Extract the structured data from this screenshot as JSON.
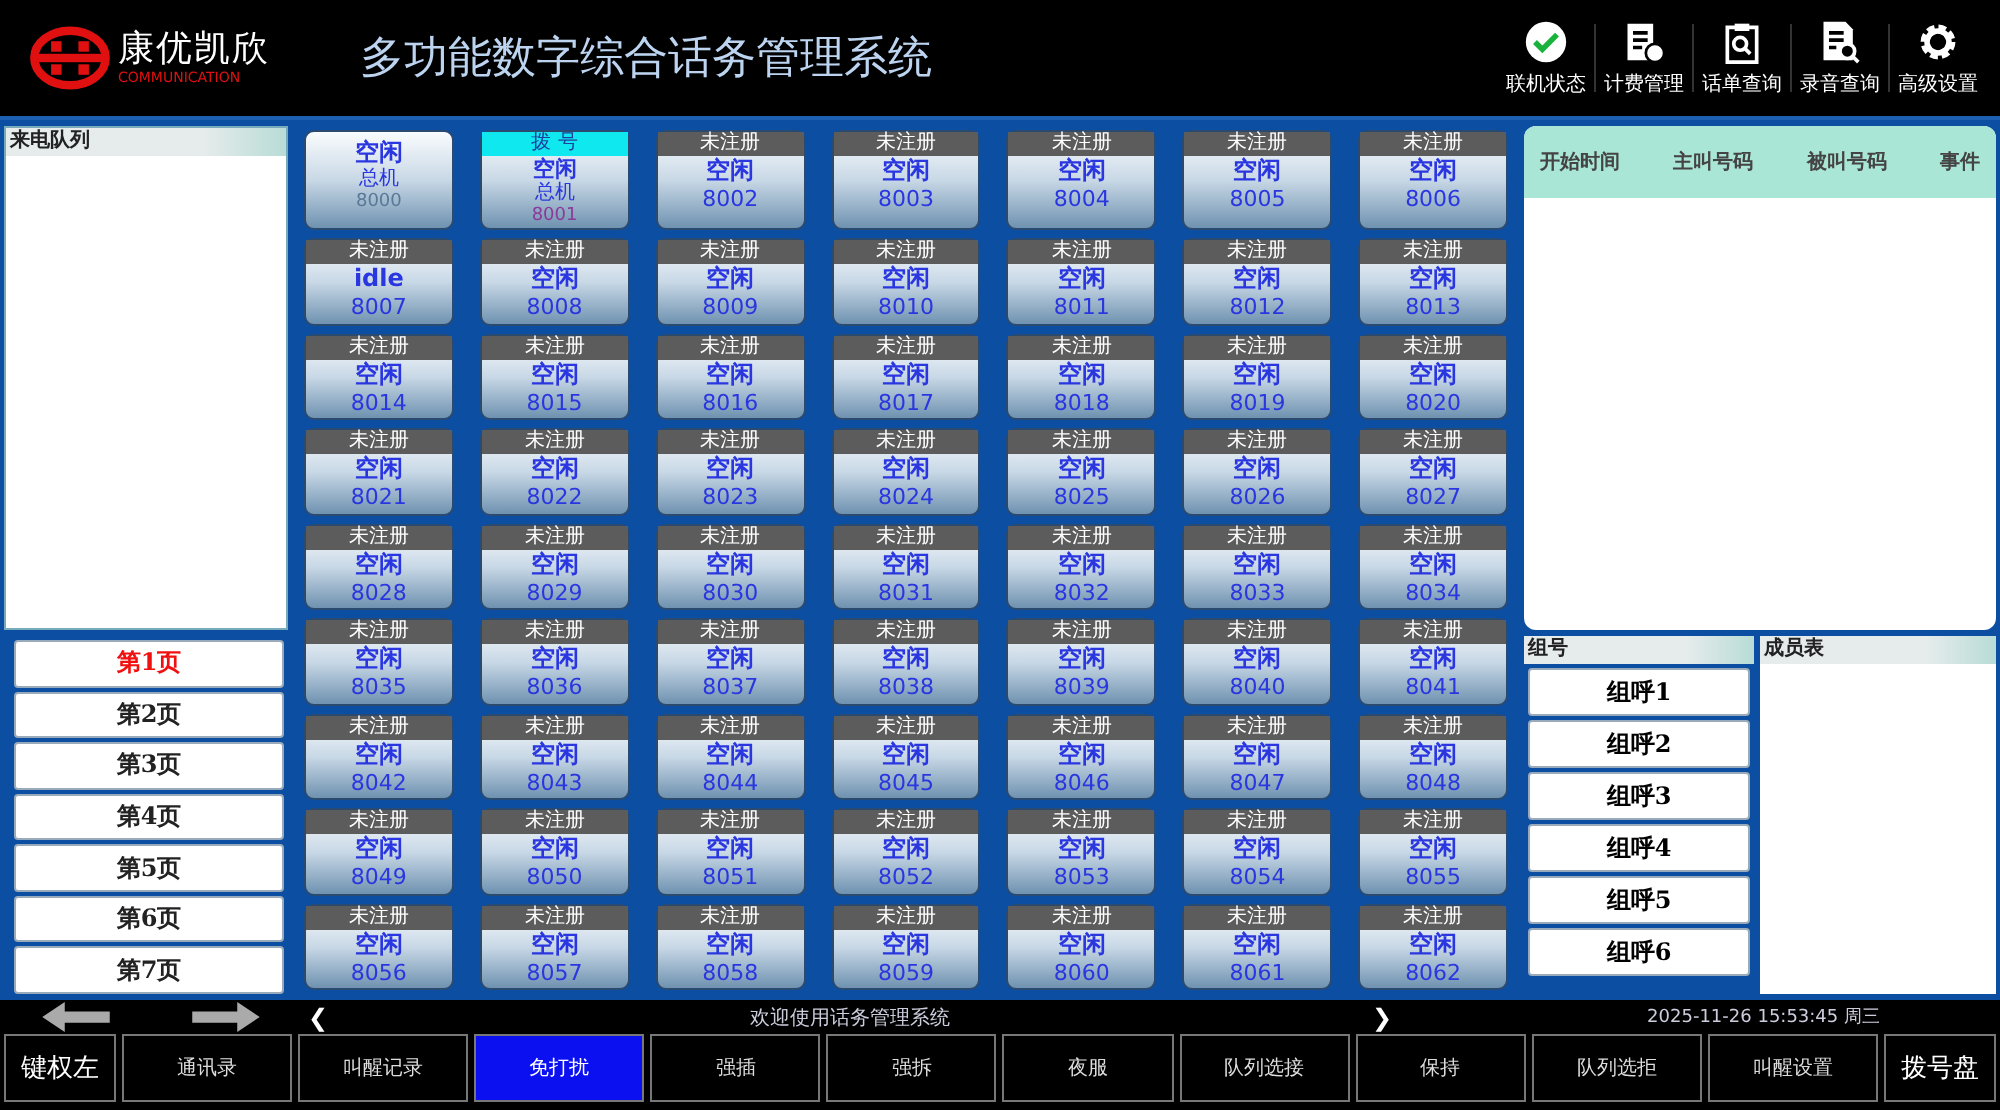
{
  "header": {
    "logo_text": "康优凯欣",
    "logo_sub": "COMMUNICATION",
    "title": "多功能数字综合话务管理系统",
    "tools": [
      {
        "kind": "check",
        "label": "联机状态"
      },
      {
        "kind": "billing",
        "label": "计费管理"
      },
      {
        "kind": "clipboard",
        "label": "话单查询"
      },
      {
        "kind": "document",
        "label": "录音查询"
      },
      {
        "kind": "gear",
        "label": "高级设置"
      }
    ]
  },
  "queue": {
    "title": "来电队列"
  },
  "pages": [
    {
      "label": "第1页",
      "selected": true
    },
    {
      "label": "第2页",
      "selected": false
    },
    {
      "label": "第3页",
      "selected": false
    },
    {
      "label": "第4页",
      "selected": false
    },
    {
      "label": "第5页",
      "selected": false
    },
    {
      "label": "第6页",
      "selected": false
    },
    {
      "label": "第7页",
      "selected": false
    }
  ],
  "extensions": [
    {
      "kind": "plain",
      "status": "空闲",
      "name": "总机",
      "number": "8000"
    },
    {
      "kind": "dialing",
      "tag": "拨 号",
      "status": "空闲",
      "name": "总机",
      "number": "8001"
    },
    {
      "kind": "unregistered",
      "tag": "未注册",
      "status": "空闲",
      "number": "8002"
    },
    {
      "kind": "unregistered",
      "tag": "未注册",
      "status": "空闲",
      "number": "8003"
    },
    {
      "kind": "unregistered",
      "tag": "未注册",
      "status": "空闲",
      "number": "8004"
    },
    {
      "kind": "unregistered",
      "tag": "未注册",
      "status": "空闲",
      "number": "8005"
    },
    {
      "kind": "unregistered",
      "tag": "未注册",
      "status": "空闲",
      "number": "8006"
    },
    {
      "kind": "unregistered",
      "tag": "未注册",
      "status": "idle",
      "number": "8007"
    },
    {
      "kind": "unregistered",
      "tag": "未注册",
      "status": "空闲",
      "number": "8008"
    },
    {
      "kind": "unregistered",
      "tag": "未注册",
      "status": "空闲",
      "number": "8009"
    },
    {
      "kind": "unregistered",
      "tag": "未注册",
      "status": "空闲",
      "number": "8010"
    },
    {
      "kind": "unregistered",
      "tag": "未注册",
      "status": "空闲",
      "number": "8011"
    },
    {
      "kind": "unregistered",
      "tag": "未注册",
      "status": "空闲",
      "number": "8012"
    },
    {
      "kind": "unregistered",
      "tag": "未注册",
      "status": "空闲",
      "number": "8013"
    },
    {
      "kind": "unregistered",
      "tag": "未注册",
      "status": "空闲",
      "number": "8014"
    },
    {
      "kind": "unregistered",
      "tag": "未注册",
      "status": "空闲",
      "number": "8015"
    },
    {
      "kind": "unregistered",
      "tag": "未注册",
      "status": "空闲",
      "number": "8016"
    },
    {
      "kind": "unregistered",
      "tag": "未注册",
      "status": "空闲",
      "number": "8017"
    },
    {
      "kind": "unregistered",
      "tag": "未注册",
      "status": "空闲",
      "number": "8018"
    },
    {
      "kind": "unregistered",
      "tag": "未注册",
      "status": "空闲",
      "number": "8019"
    },
    {
      "kind": "unregistered",
      "tag": "未注册",
      "status": "空闲",
      "number": "8020"
    },
    {
      "kind": "unregistered",
      "tag": "未注册",
      "status": "空闲",
      "number": "8021"
    },
    {
      "kind": "unregistered",
      "tag": "未注册",
      "status": "空闲",
      "number": "8022"
    },
    {
      "kind": "unregistered",
      "tag": "未注册",
      "status": "空闲",
      "number": "8023"
    },
    {
      "kind": "unregistered",
      "tag": "未注册",
      "status": "空闲",
      "number": "8024"
    },
    {
      "kind": "unregistered",
      "tag": "未注册",
      "status": "空闲",
      "number": "8025"
    },
    {
      "kind": "unregistered",
      "tag": "未注册",
      "status": "空闲",
      "number": "8026"
    },
    {
      "kind": "unregistered",
      "tag": "未注册",
      "status": "空闲",
      "number": "8027"
    },
    {
      "kind": "unregistered",
      "tag": "未注册",
      "status": "空闲",
      "number": "8028"
    },
    {
      "kind": "unregistered",
      "tag": "未注册",
      "status": "空闲",
      "number": "8029"
    },
    {
      "kind": "unregistered",
      "tag": "未注册",
      "status": "空闲",
      "number": "8030"
    },
    {
      "kind": "unregistered",
      "tag": "未注册",
      "status": "空闲",
      "number": "8031"
    },
    {
      "kind": "unregistered",
      "tag": "未注册",
      "status": "空闲",
      "number": "8032"
    },
    {
      "kind": "unregistered",
      "tag": "未注册",
      "status": "空闲",
      "number": "8033"
    },
    {
      "kind": "unregistered",
      "tag": "未注册",
      "status": "空闲",
      "number": "8034"
    },
    {
      "kind": "unregistered",
      "tag": "未注册",
      "status": "空闲",
      "number": "8035"
    },
    {
      "kind": "unregistered",
      "tag": "未注册",
      "status": "空闲",
      "number": "8036"
    },
    {
      "kind": "unregistered",
      "tag": "未注册",
      "status": "空闲",
      "number": "8037"
    },
    {
      "kind": "unregistered",
      "tag": "未注册",
      "status": "空闲",
      "number": "8038"
    },
    {
      "kind": "unregistered",
      "tag": "未注册",
      "status": "空闲",
      "number": "8039"
    },
    {
      "kind": "unregistered",
      "tag": "未注册",
      "status": "空闲",
      "number": "8040"
    },
    {
      "kind": "unregistered",
      "tag": "未注册",
      "status": "空闲",
      "number": "8041"
    },
    {
      "kind": "unregistered",
      "tag": "未注册",
      "status": "空闲",
      "number": "8042"
    },
    {
      "kind": "unregistered",
      "tag": "未注册",
      "status": "空闲",
      "number": "8043"
    },
    {
      "kind": "unregistered",
      "tag": "未注册",
      "status": "空闲",
      "number": "8044"
    },
    {
      "kind": "unregistered",
      "tag": "未注册",
      "status": "空闲",
      "number": "8045"
    },
    {
      "kind": "unregistered",
      "tag": "未注册",
      "status": "空闲",
      "number": "8046"
    },
    {
      "kind": "unregistered",
      "tag": "未注册",
      "status": "空闲",
      "number": "8047"
    },
    {
      "kind": "unregistered",
      "tag": "未注册",
      "status": "空闲",
      "number": "8048"
    },
    {
      "kind": "unregistered",
      "tag": "未注册",
      "status": "空闲",
      "number": "8049"
    },
    {
      "kind": "unregistered",
      "tag": "未注册",
      "status": "空闲",
      "number": "8050"
    },
    {
      "kind": "unregistered",
      "tag": "未注册",
      "status": "空闲",
      "number": "8051"
    },
    {
      "kind": "unregistered",
      "tag": "未注册",
      "status": "空闲",
      "number": "8052"
    },
    {
      "kind": "unregistered",
      "tag": "未注册",
      "status": "空闲",
      "number": "8053"
    },
    {
      "kind": "unregistered",
      "tag": "未注册",
      "status": "空闲",
      "number": "8054"
    },
    {
      "kind": "unregistered",
      "tag": "未注册",
      "status": "空闲",
      "number": "8055"
    },
    {
      "kind": "unregistered",
      "tag": "未注册",
      "status": "空闲",
      "number": "8056"
    },
    {
      "kind": "unregistered",
      "tag": "未注册",
      "status": "空闲",
      "number": "8057"
    },
    {
      "kind": "unregistered",
      "tag": "未注册",
      "status": "空闲",
      "number": "8058"
    },
    {
      "kind": "unregistered",
      "tag": "未注册",
      "status": "空闲",
      "number": "8059"
    },
    {
      "kind": "unregistered",
      "tag": "未注册",
      "status": "空闲",
      "number": "8060"
    },
    {
      "kind": "unregistered",
      "tag": "未注册",
      "status": "空闲",
      "number": "8061"
    },
    {
      "kind": "unregistered",
      "tag": "未注册",
      "status": "空闲",
      "number": "8062"
    }
  ],
  "call_log": {
    "columns": [
      "开始时间",
      "主叫号码",
      "被叫号码",
      "事件"
    ]
  },
  "groups": {
    "title": "组号",
    "items": [
      "组呼1",
      "组呼2",
      "组呼3",
      "组呼4",
      "组呼5",
      "组呼6"
    ]
  },
  "members": {
    "title": "成员表"
  },
  "status_bar": {
    "prev": "❮",
    "message": "欢迎使用话务管理系统",
    "next": "❯",
    "datetime": "2025-11-26 15:53:45 周三"
  },
  "functions": [
    {
      "label": "键权左",
      "kind": "large",
      "selected": false
    },
    {
      "label": "通讯录",
      "kind": "normal",
      "selected": false
    },
    {
      "label": "叫醒记录",
      "kind": "normal",
      "selected": false
    },
    {
      "label": "免打扰",
      "kind": "normal",
      "selected": true
    },
    {
      "label": "强插",
      "kind": "normal",
      "selected": false
    },
    {
      "label": "强拆",
      "kind": "normal",
      "selected": false
    },
    {
      "label": "夜服",
      "kind": "normal",
      "selected": false
    },
    {
      "label": "队列选接",
      "kind": "normal",
      "selected": false
    },
    {
      "label": "保持",
      "kind": "normal",
      "selected": false
    },
    {
      "label": "队列选拒",
      "kind": "normal",
      "selected": false
    },
    {
      "label": "叫醒设置",
      "kind": "normal",
      "selected": false
    },
    {
      "label": "拨号盘",
      "kind": "large",
      "selected": false
    }
  ]
}
